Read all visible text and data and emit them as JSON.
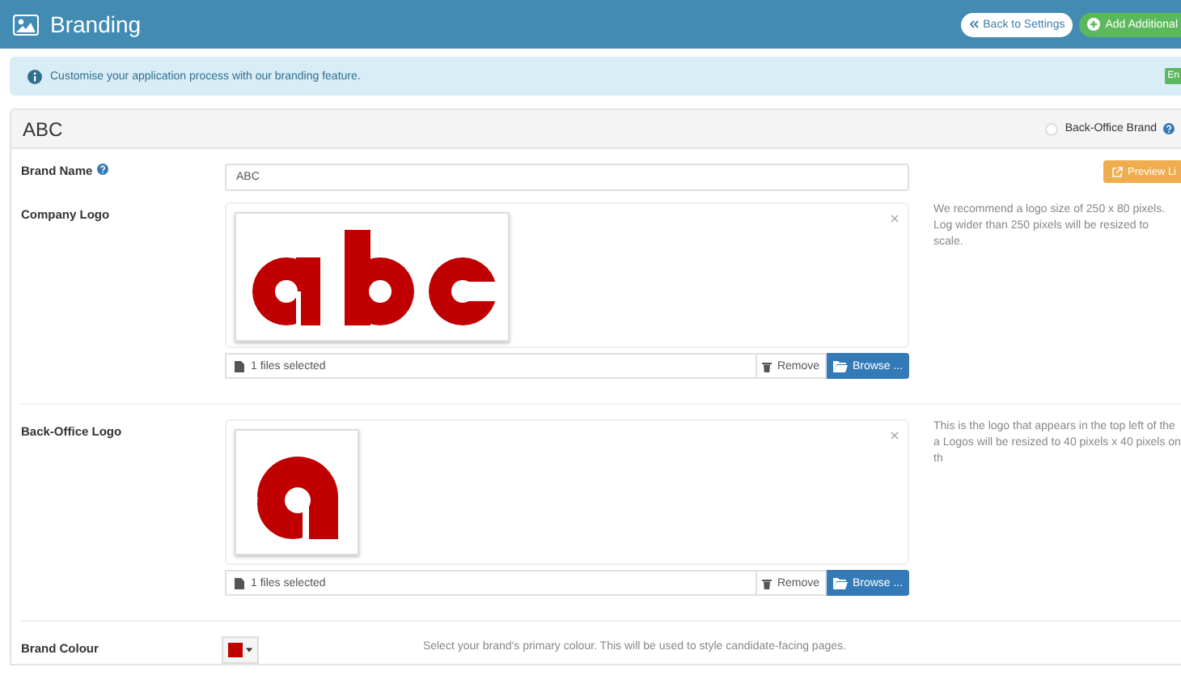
{
  "header": {
    "title": "Branding",
    "buttons": [
      {
        "label": "Back to Settings",
        "kind": "back"
      },
      {
        "label": "Add Additional",
        "kind": "add"
      }
    ]
  },
  "alert": {
    "text": "Customise your application process with our branding feature.",
    "badge": "En"
  },
  "panel": {
    "title": "ABC",
    "back_office_brand": {
      "label": "Back-Office Brand",
      "checked": false
    }
  },
  "brand_name": {
    "label": "Brand Name",
    "value": "ABC",
    "preview_button": "Preview Li"
  },
  "logos": [
    {
      "label": "Company Logo",
      "kind": "wide",
      "file_caption": "1 files selected",
      "remove": "Remove",
      "browse": "Browse ...",
      "help": "We recommend a logo size of 250 x 80 pixels. Log wider than 250 pixels will be resized to scale."
    },
    {
      "label": "Back-Office Logo",
      "kind": "square",
      "file_caption": "1 files selected",
      "remove": "Remove",
      "browse": "Browse ...",
      "help": "This is the logo that appears in the top left of the a Logos will be resized to 40 pixels x 40 pixels on th"
    }
  ],
  "brand_colour": {
    "label": "Brand Colour",
    "color": "#c00000",
    "help": "Select your brand's primary colour. This will be used to style candidate-facing pages."
  }
}
